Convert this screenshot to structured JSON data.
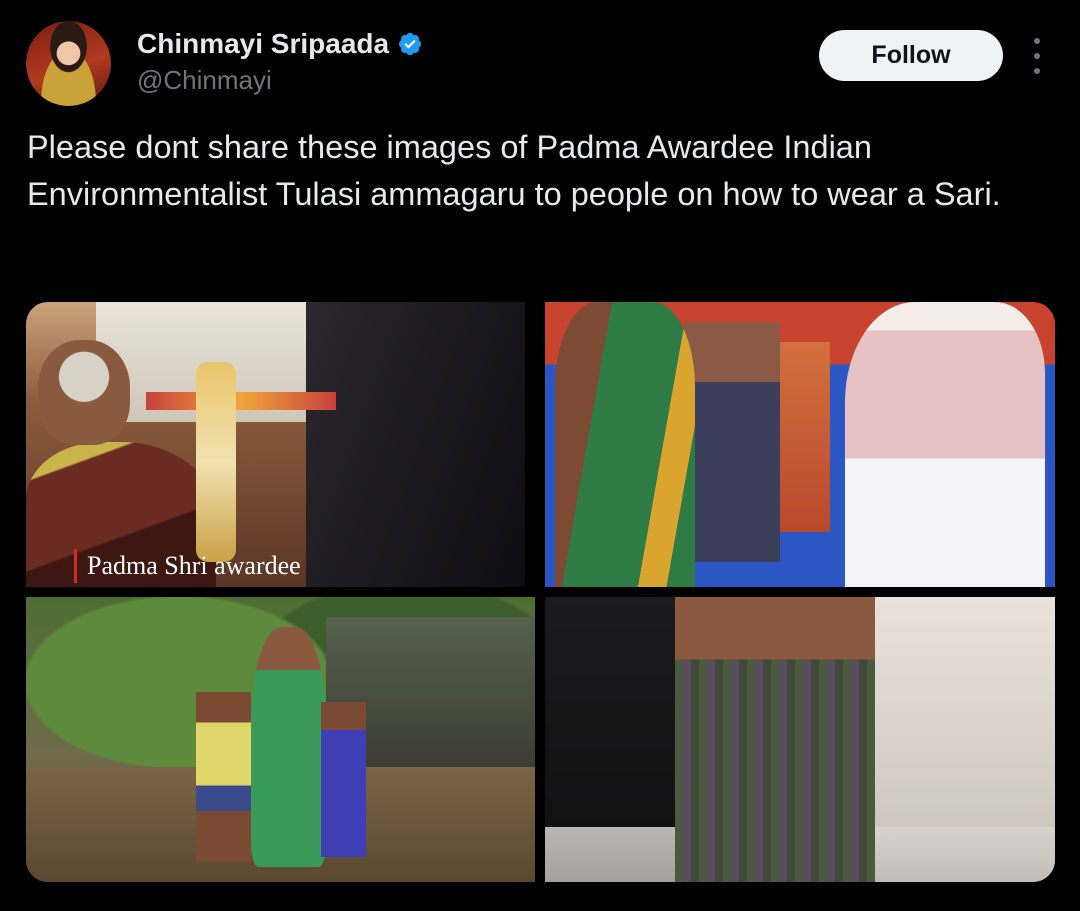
{
  "tweet": {
    "author": {
      "display_name": "Chinmayi Sripaada",
      "handle": "@Chinmayi",
      "verified": true
    },
    "follow_label": "Follow",
    "more_icon": "more-vertical-icon",
    "text": "Please dont share these images of Padma Awardee Indian Environmentalist Tulasi ammagaru to people on how to wear a Sari.",
    "media": {
      "photo_count": 4,
      "photo_1_caption": "Padma Shri awardee"
    }
  },
  "colors": {
    "background": "#000000",
    "primary_text": "#e7e9ea",
    "secondary_text": "#71767b",
    "follow_bg": "#eff3f4",
    "follow_text": "#0f1419",
    "verified_badge": "#1d9bf0"
  }
}
